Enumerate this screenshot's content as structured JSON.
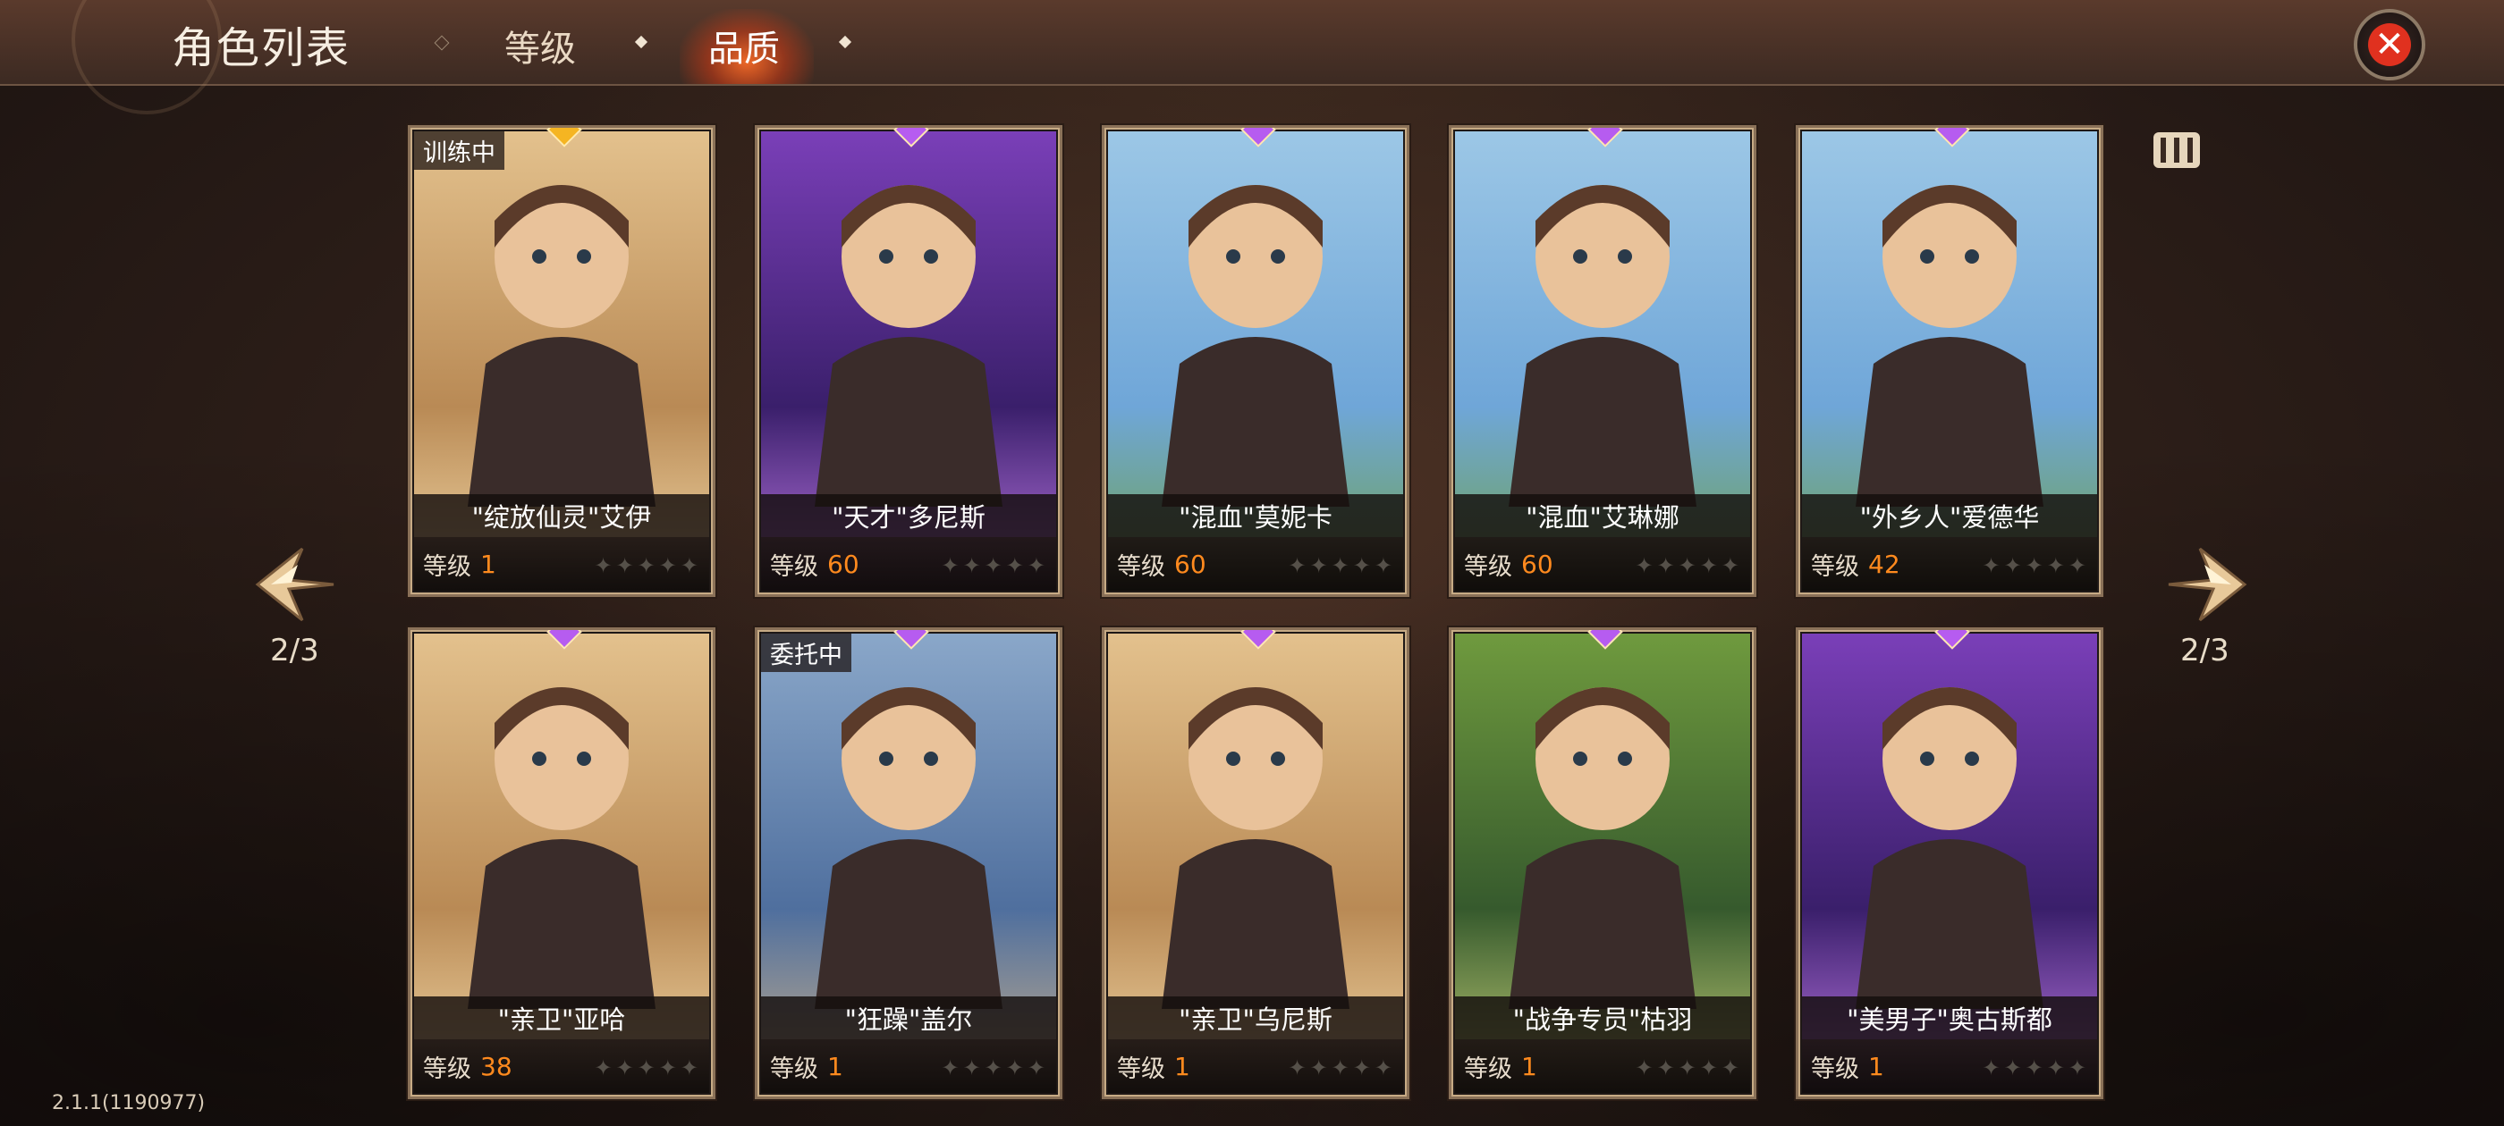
{
  "header": {
    "title": "角色列表",
    "tabs": [
      {
        "label": "等级",
        "active": false
      },
      {
        "label": "品质",
        "active": true
      }
    ]
  },
  "pagination": {
    "left": "2/3",
    "right": "2/3"
  },
  "version": "2.1.1(1190977)",
  "level_label": "等级",
  "colors": {
    "gem_gold": "#f5b522",
    "gem_purple": "#b65cf0",
    "level_value": "#ff8a1e",
    "close_red": "#e0311f"
  },
  "characters": [
    {
      "name": "\"绽放仙灵\"艾伊",
      "level": "1",
      "gem": "gold",
      "status": "训练中",
      "theme": "desert"
    },
    {
      "name": "\"天才\"多尼斯",
      "level": "60",
      "gem": "purple",
      "status": "",
      "theme": "purple"
    },
    {
      "name": "\"混血\"莫妮卡",
      "level": "60",
      "gem": "purple",
      "status": "",
      "theme": "meadow"
    },
    {
      "name": "\"混血\"艾琳娜",
      "level": "60",
      "gem": "purple",
      "status": "",
      "theme": "meadow"
    },
    {
      "name": "\"外乡人\"爱德华",
      "level": "42",
      "gem": "purple",
      "status": "",
      "theme": "meadow"
    },
    {
      "name": "\"亲卫\"亚哈",
      "level": "38",
      "gem": "purple",
      "status": "",
      "theme": "desert"
    },
    {
      "name": "\"狂躁\"盖尔",
      "level": "1",
      "gem": "purple",
      "status": "委托中",
      "theme": "mountain"
    },
    {
      "name": "\"亲卫\"乌尼斯",
      "level": "1",
      "gem": "purple",
      "status": "",
      "theme": "desert"
    },
    {
      "name": "\"战争专员\"枯羽",
      "level": "1",
      "gem": "purple",
      "status": "",
      "theme": "forest"
    },
    {
      "name": "\"美男子\"奥古斯都",
      "level": "1",
      "gem": "purple",
      "status": "",
      "theme": "purple"
    }
  ]
}
